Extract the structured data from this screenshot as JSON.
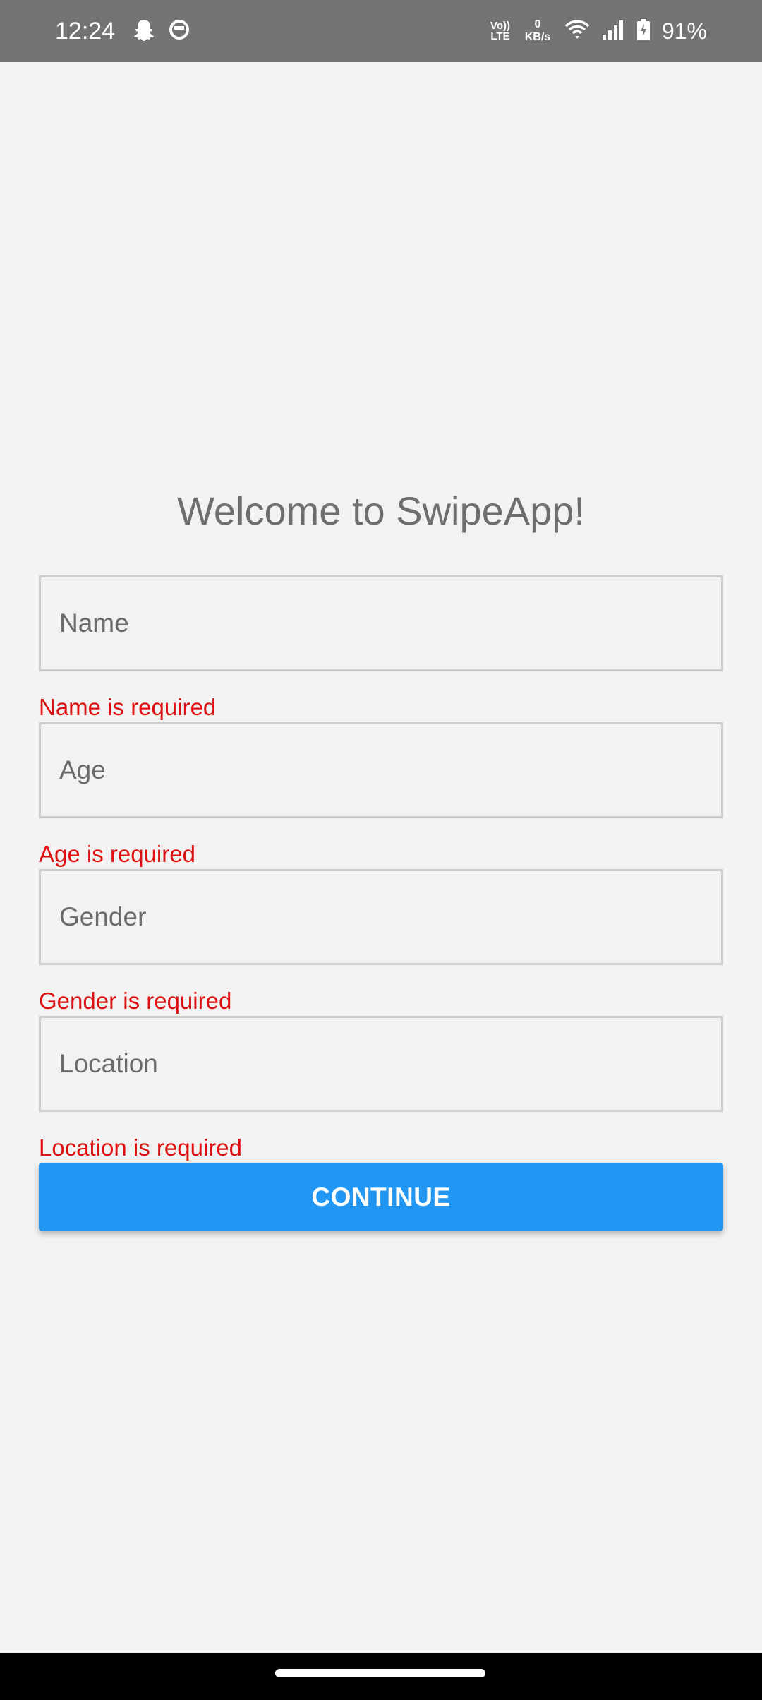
{
  "status_bar": {
    "time": "12:24",
    "volte_top": "Vo))",
    "volte_bottom": "LTE",
    "net_speed_value": "0",
    "net_speed_unit": "KB/s",
    "battery": "91%"
  },
  "screen": {
    "title": "Welcome to SwipeApp!"
  },
  "form": {
    "fields": [
      {
        "placeholder": "Name",
        "error": "Name is required"
      },
      {
        "placeholder": "Age",
        "error": "Age is required"
      },
      {
        "placeholder": "Gender",
        "error": "Gender is required"
      },
      {
        "placeholder": "Location",
        "error": "Location is required"
      }
    ],
    "submit_label": "CONTINUE"
  },
  "colors": {
    "background": "#f2f2f2",
    "status_bar": "#737373",
    "error": "#dd1111",
    "button": "#2196f3",
    "title_text": "#6e6e6e"
  },
  "icons": {
    "status_left": [
      "snapchat-ghost-icon",
      "app-notification-icon"
    ],
    "status_right": [
      "volte-icon",
      "wifi-icon",
      "cell-signal-icon",
      "battery-charging-icon"
    ]
  }
}
